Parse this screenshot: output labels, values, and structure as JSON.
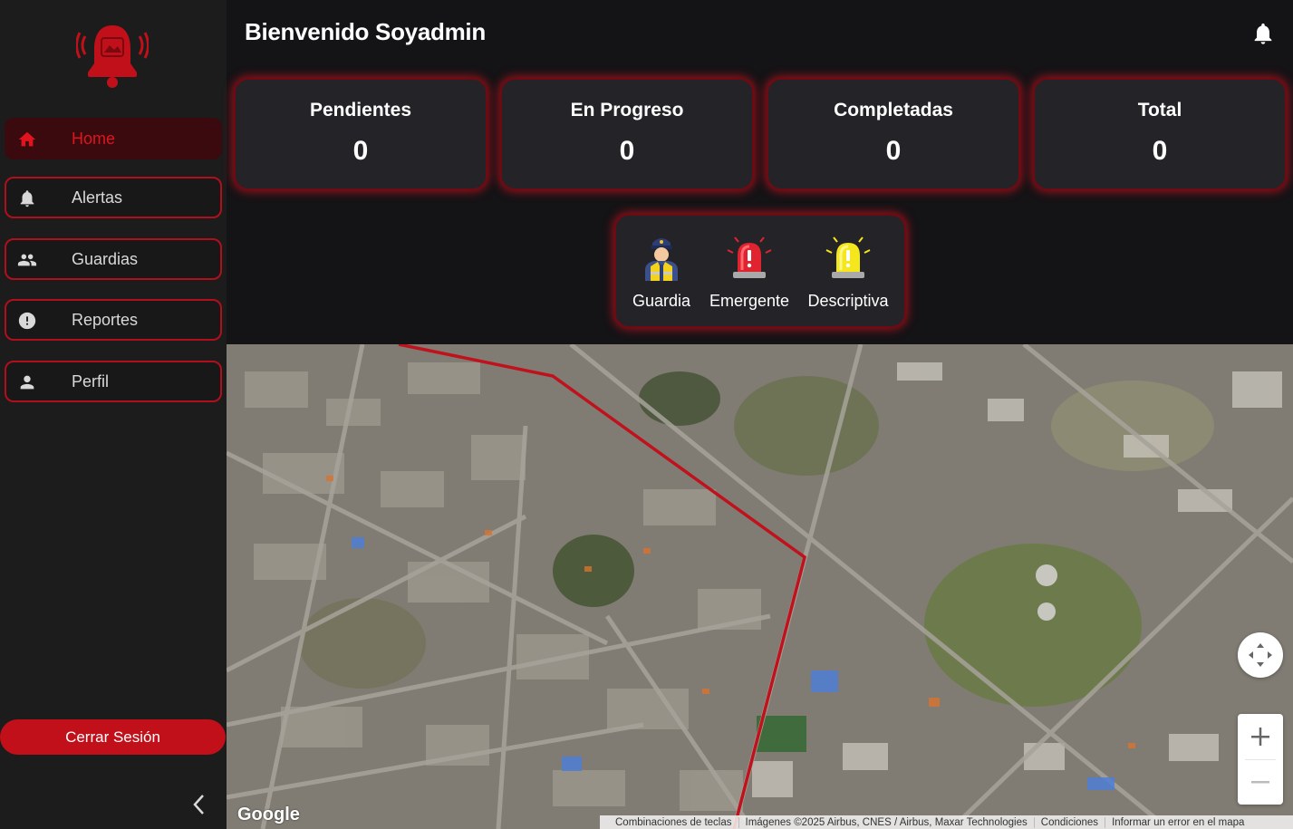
{
  "header": {
    "welcome": "Bienvenido Soyadmin"
  },
  "sidebar": {
    "items": [
      {
        "label": "Home",
        "icon": "home-icon",
        "active": true
      },
      {
        "label": "Alertas",
        "icon": "bell-icon",
        "active": false
      },
      {
        "label": "Guardias",
        "icon": "people-icon",
        "active": false
      },
      {
        "label": "Reportes",
        "icon": "alert-circle-icon",
        "active": false
      },
      {
        "label": "Perfil",
        "icon": "person-icon",
        "active": false
      }
    ],
    "logout_label": "Cerrar Sesión"
  },
  "stats": [
    {
      "title": "Pendientes",
      "value": "0"
    },
    {
      "title": "En Progreso",
      "value": "0"
    },
    {
      "title": "Completadas",
      "value": "0"
    },
    {
      "title": "Total",
      "value": "0"
    }
  ],
  "legend": [
    {
      "label": "Guardia",
      "icon": "guard-icon"
    },
    {
      "label": "Emergente",
      "icon": "red-siren-icon"
    },
    {
      "label": "Descriptiva",
      "icon": "yellow-siren-icon"
    }
  ],
  "map": {
    "provider": "Google",
    "attribution": [
      "Combinaciones de teclas",
      "Imágenes ©2025 Airbus, CNES / Airbus, Maxar Technologies",
      "Condiciones",
      "Informar un error en el mapa"
    ]
  },
  "colors": {
    "accent": "#c1101a",
    "background": "#141316",
    "sidebar": "#1c1c1c",
    "card": "#242327"
  }
}
